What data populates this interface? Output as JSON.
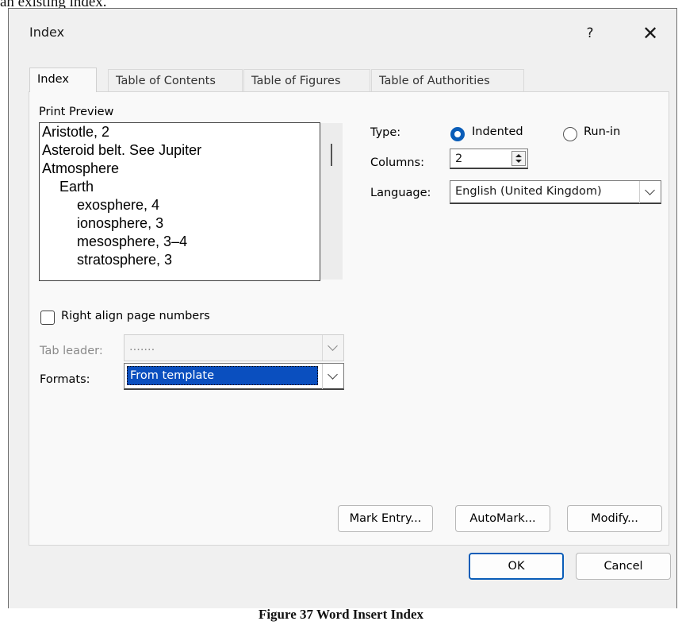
{
  "doc_fragment": "an existing index.",
  "caption": "Figure 37 Word Insert Index",
  "dialog": {
    "title": "Index",
    "help_glyph": "?",
    "close_glyph": "✕"
  },
  "tabs": [
    {
      "label": "Index",
      "active": true
    },
    {
      "label": "Table of Contents",
      "active": false
    },
    {
      "label": "Table of Figures",
      "active": false
    },
    {
      "label": "Table of Authorities",
      "active": false
    }
  ],
  "preview": {
    "label": "Print Preview",
    "lines": [
      {
        "text": "Aristotle, 2",
        "indent": 0
      },
      {
        "text": "Asteroid belt. See Jupiter",
        "indent": 0
      },
      {
        "text": "Atmosphere",
        "indent": 0
      },
      {
        "text": "Earth",
        "indent": 1
      },
      {
        "text": "exosphere, 4",
        "indent": 2
      },
      {
        "text": "ionosphere, 3",
        "indent": 2
      },
      {
        "text": "mesosphere, 3–4",
        "indent": 2
      },
      {
        "text": "stratosphere, 3",
        "indent": 2
      }
    ]
  },
  "type": {
    "label": "Type:",
    "options": [
      {
        "label": "Indented",
        "selected": true
      },
      {
        "label": "Run-in",
        "selected": false
      }
    ]
  },
  "columns": {
    "label": "Columns:",
    "value": "2"
  },
  "language": {
    "label": "Language:",
    "value": "English (United Kingdom)"
  },
  "right_align": {
    "label": "Right align page numbers",
    "checked": false
  },
  "tab_leader": {
    "label": "Tab leader:",
    "value": "......."
  },
  "formats": {
    "label": "Formats:",
    "value": "From template"
  },
  "buttons": {
    "mark_entry": "Mark Entry...",
    "automark": "AutoMark...",
    "modify": "Modify...",
    "ok": "OK",
    "cancel": "Cancel"
  },
  "colors": {
    "accent": "#0a5db8",
    "selection": "#0a4fbf"
  },
  "icons": [
    "help-icon",
    "close-icon",
    "chevron-down-icon",
    "spin-up-icon",
    "spin-down-icon",
    "radio-icon",
    "checkbox-icon"
  ]
}
